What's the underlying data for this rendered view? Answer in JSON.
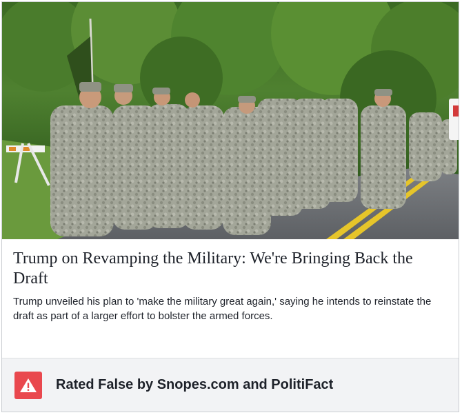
{
  "article": {
    "headline": "Trump on Revamping the Military: We're Bringing Back the Draft",
    "summary": "Trump unveiled his plan to 'make the military great again,' saying he intends to reinstate the draft as part of a larger effort to bolster the armed forces.",
    "image_icon": "soldiers-marching-photo"
  },
  "rating": {
    "label": "Rated False by Snopes.com and PolitiFact",
    "icon": "warning-icon",
    "badge_color": "#e9484e"
  }
}
